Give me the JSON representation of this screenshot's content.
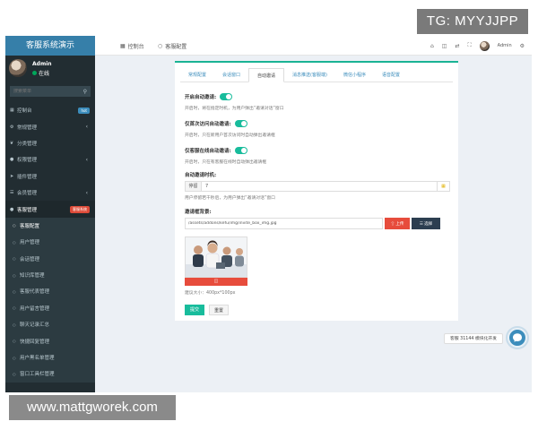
{
  "watermarks": {
    "top": "TG: MYYJJPP",
    "bottom": "www.mattgworek.com"
  },
  "sidebar": {
    "brand": "客服系统演示",
    "user": {
      "name": "Admin",
      "status": "在线"
    },
    "search_placeholder": "搜索菜单",
    "items": [
      {
        "label": "控制台",
        "icon": "dashboard-icon",
        "badge": "hot"
      },
      {
        "label": "常规管理",
        "icon": "cog-icon"
      },
      {
        "label": "分类管理",
        "icon": "leaf-icon"
      },
      {
        "label": "权限管理",
        "icon": "group-icon"
      },
      {
        "label": "插件管理",
        "icon": "rocket-icon"
      },
      {
        "label": "会员管理",
        "icon": "list-icon"
      },
      {
        "label": "客服管理",
        "icon": "users-icon",
        "badge": "客服系统"
      }
    ],
    "subitems": [
      "客服配置",
      "用户管理",
      "会话管理",
      "知识库管理",
      "客服代表管理",
      "用户留言管理",
      "聊天记录汇总",
      "快捷回复管理",
      "用户黑名单管理",
      "窗口工具栏管理"
    ]
  },
  "navbar": {
    "tabs": [
      {
        "label": "控制台",
        "icon": "dashboard-icon"
      },
      {
        "label": "客服配置",
        "icon": "circle-icon"
      }
    ],
    "admin": "Admin"
  },
  "panel": {
    "tabs": [
      "常规配置",
      "会话窗口",
      "自动邀请",
      "消息推送(客服端)",
      "微信小程序",
      "语音配置"
    ],
    "active_tab": 2,
    "sections": [
      {
        "title": "开启自动邀请:",
        "help": "开启时，将在指定时机，为用户弹出“邀请对话”窗口",
        "on": true
      },
      {
        "title": "仅首次访问自动邀请:",
        "help": "开启时，只在新用户首次访问时自动弹出邀请框",
        "on": true
      },
      {
        "title": "仅客服在线自动邀请:",
        "help": "开启时，只在有客服在线时自动弹出邀请框",
        "on": true
      }
    ],
    "duration": {
      "title": "自动邀请时机:",
      "prefix": "停留",
      "value": "7",
      "help": "用户停留若干秒后，为用户弹出“邀请对话”窗口"
    },
    "background": {
      "title": "邀请框背景:",
      "value": "/assets/addons/kefu/img/invite_box_img.jpg",
      "upload_label": "上传",
      "select_label": "选择"
    },
    "size_hint": "建议大小：400px*100px",
    "submit_label": "提交",
    "reset_label": "重置"
  },
  "chat": {
    "tip": "客服 31144 模块化开发"
  }
}
